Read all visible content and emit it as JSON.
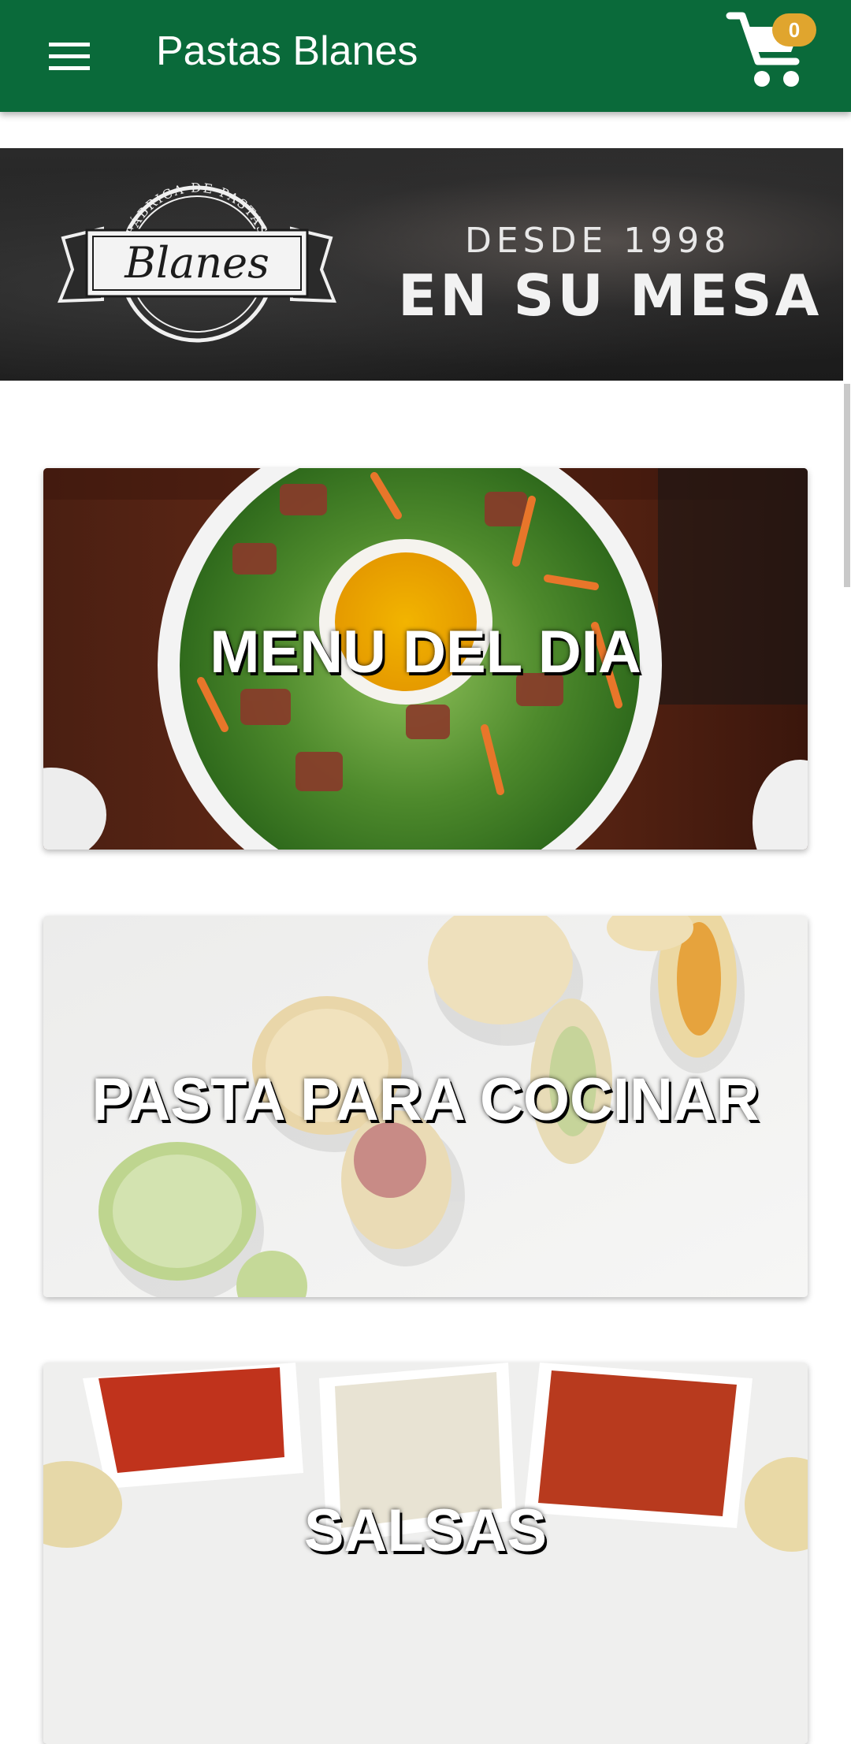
{
  "app_bar": {
    "title": "Pastas Blanes",
    "menu_icon": "hamburger-menu-icon",
    "cart_icon": "shopping-cart-icon",
    "cart_count": "0",
    "background_color": "#0a6a3a",
    "badge_color": "#e0a52e"
  },
  "banner": {
    "logo_text": "Blanes",
    "logo_arc_text": "FÁBRICA DE PASTAS",
    "since_text": "DESDE 1998",
    "tagline": "EN SU MESA"
  },
  "categories": [
    {
      "label": "MENU DEL DIA"
    },
    {
      "label": "PASTA PARA COCINAR"
    },
    {
      "label": "SALSAS"
    }
  ]
}
